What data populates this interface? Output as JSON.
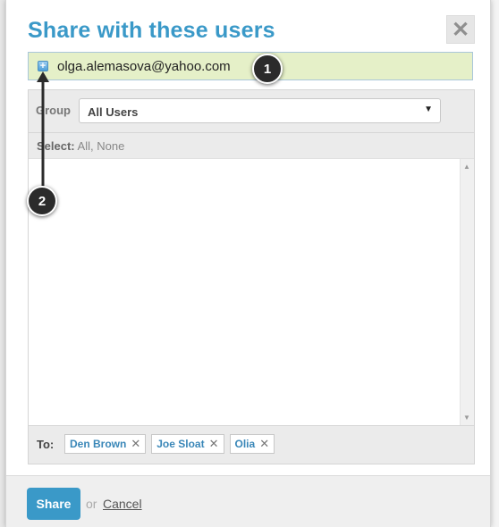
{
  "dialog": {
    "title": "Share with these users",
    "close_label": "✕"
  },
  "email_input": {
    "value": "olga.alemasova@yahoo.com",
    "add_icon": "plus-icon"
  },
  "group": {
    "label": "Group",
    "selected": "All Users"
  },
  "select_line": {
    "label": "Select:",
    "all": "All",
    "separator": ",",
    "none": "None"
  },
  "to": {
    "label": "To:",
    "recipients": [
      {
        "name": "Den Brown"
      },
      {
        "name": "Joe Sloat"
      },
      {
        "name": "Olia"
      }
    ],
    "remove_glyph": "✕"
  },
  "footer": {
    "share_label": "Share",
    "or_text": "or",
    "cancel_label": "Cancel"
  },
  "annotations": {
    "marker_1": "1",
    "marker_2": "2"
  },
  "colors": {
    "accent": "#3a99c8",
    "input_highlight": "#e5f0c8",
    "marker": "#2b2b2b"
  }
}
